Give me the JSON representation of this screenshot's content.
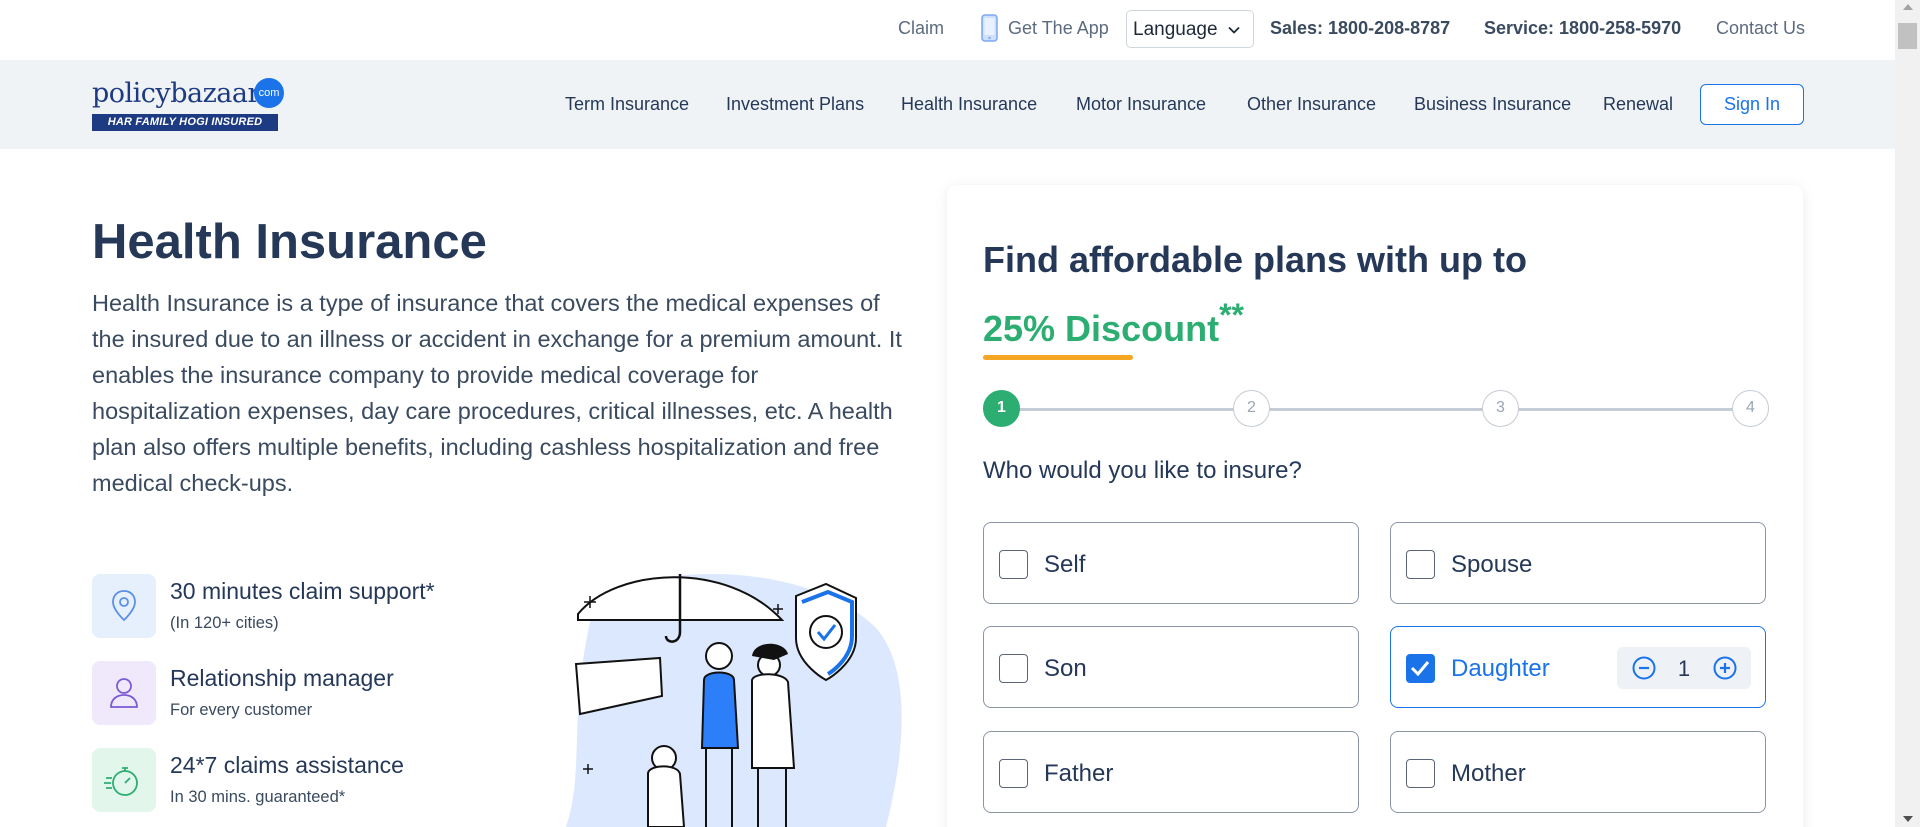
{
  "topbar": {
    "claim": "Claim",
    "get_app": "Get The App",
    "language": "Language",
    "sales": "Sales: 1800-208-8787",
    "service": "Service: 1800-258-5970",
    "contact": "Contact Us"
  },
  "logo": {
    "word_a": "policy",
    "word_b": "bazaar",
    "dotcom": "com",
    "tagline": "HAR FAMILY HOGI INSURED"
  },
  "nav": {
    "items": [
      "Term Insurance",
      "Investment Plans",
      "Health Insurance",
      "Motor Insurance",
      "Other Insurance",
      "Business Insurance",
      "Renewal"
    ],
    "sign_in": "Sign In"
  },
  "hero": {
    "title": "Health Insurance",
    "description": "Health Insurance is a type of insurance that covers the medical expenses of the insured due to an illness or accident in exchange for a premium amount. It enables the insurance company to provide medical coverage for hospitalization expenses, day care procedures, critical illnesses, etc. A health plan also offers multiple benefits, including cashless hospitalization and free medical check-ups."
  },
  "features": [
    {
      "title": "30 minutes claim support*",
      "sub": "(In 120+ cities)",
      "icon": "location-pin-icon"
    },
    {
      "title": "Relationship manager",
      "sub": "For every customer",
      "icon": "person-icon"
    },
    {
      "title": "24*7 claims assistance",
      "sub": "In 30 mins. guaranteed*",
      "icon": "stopwatch-icon"
    }
  ],
  "form": {
    "heading": "Find affordable plans with up to",
    "discount": "25% Discount",
    "discount_mark": "**",
    "steps": [
      "1",
      "2",
      "3",
      "4"
    ],
    "current_step": 1,
    "question": "Who would you like to insure?",
    "options": [
      {
        "label": "Self",
        "checked": false
      },
      {
        "label": "Spouse",
        "checked": false
      },
      {
        "label": "Son",
        "checked": false
      },
      {
        "label": "Daughter",
        "checked": true,
        "count": "1"
      },
      {
        "label": "Father",
        "checked": false
      },
      {
        "label": "Mother",
        "checked": false
      }
    ]
  },
  "colors": {
    "brand_blue": "#1a73e8",
    "navy": "#253858",
    "green": "#2cae72",
    "orange": "#f5a623",
    "nav_bg": "#f0f3f6"
  }
}
